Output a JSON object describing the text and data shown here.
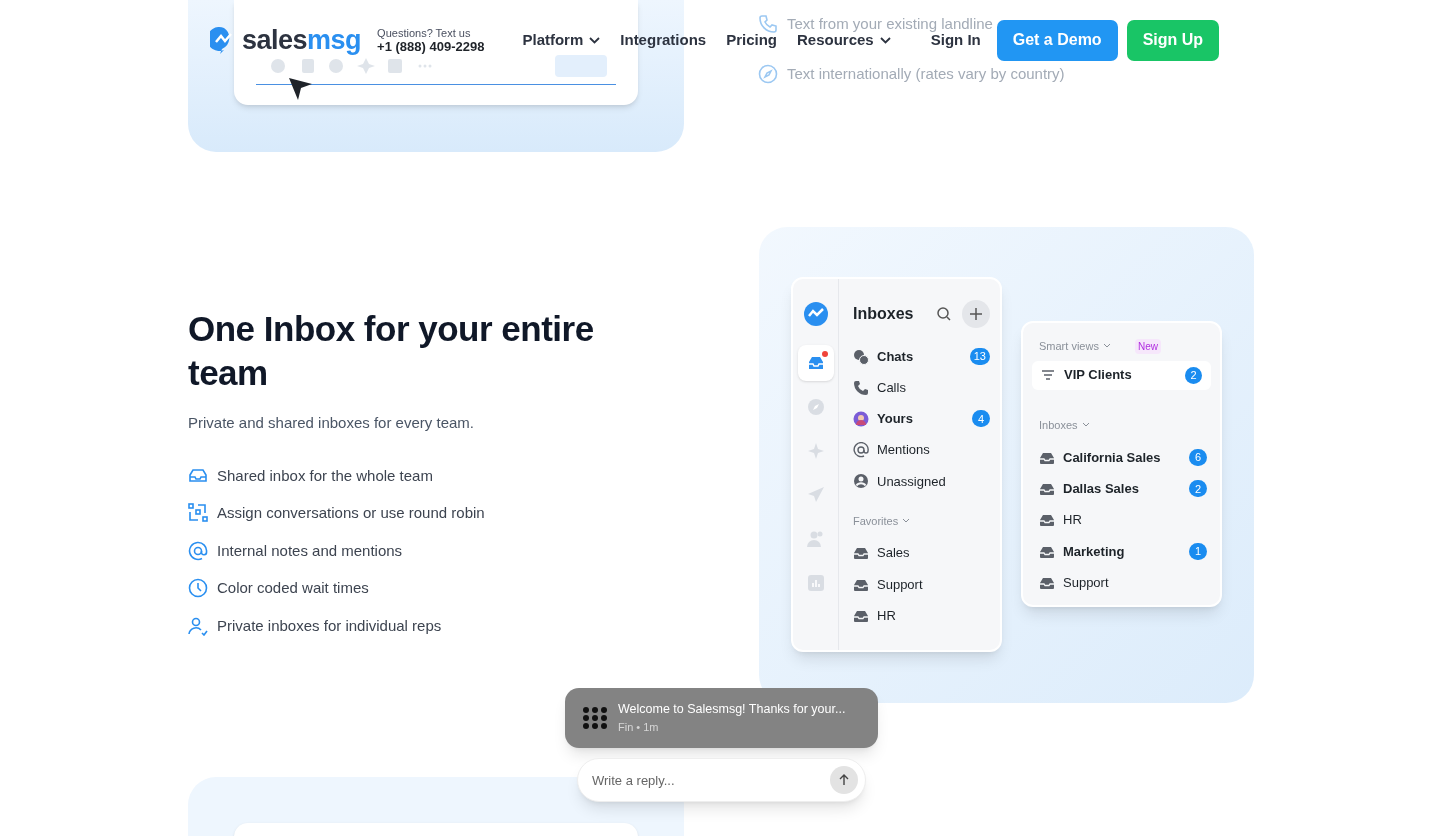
{
  "header": {
    "logo": {
      "part_1": "sales",
      "part_2": "msg"
    },
    "contact_label": "Questions? Text us",
    "phone": "+1 (888) 409-2298",
    "nav": [
      {
        "label": "Platform",
        "dropdown": true
      },
      {
        "label": "Integrations",
        "dropdown": false
      },
      {
        "label": "Pricing",
        "dropdown": false
      },
      {
        "label": "Resources",
        "dropdown": true
      }
    ],
    "sign_in": "Sign In",
    "demo_button": "Get a Demo",
    "signup_button": "Sign Up"
  },
  "previous_section": {
    "features": [
      {
        "kind": "phone",
        "text": "Text from your existing landline"
      },
      {
        "kind": "compass",
        "text": "Text internationally (rates vary by country)"
      }
    ]
  },
  "section": {
    "title": "One Inbox for your entire team",
    "subtitle": "Private and shared inboxes for every team.",
    "features": [
      {
        "kind": "inbox",
        "text": "Shared inbox for the whole team"
      },
      {
        "kind": "assign",
        "text": "Assign conversations or use round robin"
      },
      {
        "kind": "at",
        "text": "Internal notes and mentions"
      },
      {
        "kind": "clock",
        "text": "Color coded wait times"
      },
      {
        "kind": "user",
        "text": "Private inboxes for individual reps"
      }
    ]
  },
  "app_mock": {
    "rail": [
      {
        "kind": "inbox",
        "selected": true,
        "alert": true
      },
      {
        "kind": "compass",
        "selected": false,
        "alert": false
      },
      {
        "kind": "sparkle",
        "selected": false,
        "alert": false
      },
      {
        "kind": "send",
        "selected": false,
        "alert": false
      },
      {
        "kind": "users",
        "selected": false,
        "alert": false
      },
      {
        "kind": "chart",
        "selected": false,
        "alert": false
      }
    ],
    "inboxes": {
      "title": "Inboxes",
      "items": [
        {
          "kind": "chats",
          "label": "Chats",
          "unread": true,
          "count": "13"
        },
        {
          "kind": "phone",
          "label": "Calls",
          "unread": false
        },
        {
          "kind": "avatar",
          "label": "Yours",
          "unread": true,
          "count": "4"
        },
        {
          "kind": "at",
          "label": "Mentions",
          "unread": false
        },
        {
          "kind": "user",
          "label": "Unassigned",
          "unread": false
        }
      ],
      "favorites_label": "Favorites",
      "favorites": [
        {
          "label": "Sales",
          "unread": false
        },
        {
          "label": "Support",
          "unread": false
        },
        {
          "label": "HR",
          "unread": false
        }
      ]
    },
    "smart_panel": {
      "smart_views_label": "Smart views",
      "badge": "New",
      "views": [
        {
          "label": "VIP Clients",
          "count": "2"
        }
      ],
      "inboxes_label": "Inboxes",
      "inboxes": [
        {
          "label": "California Sales",
          "unread": true,
          "count": "6"
        },
        {
          "label": "Dallas Sales",
          "unread": true,
          "count": "2"
        },
        {
          "label": "HR",
          "unread": false
        },
        {
          "label": "Marketing",
          "unread": true,
          "count": "1"
        },
        {
          "label": "Support",
          "unread": false
        }
      ]
    }
  },
  "chat_widget": {
    "message": "Welcome to Salesmsg! Thanks for your...",
    "meta": "Fin • 1m",
    "reply_placeholder": "Write a reply..."
  }
}
